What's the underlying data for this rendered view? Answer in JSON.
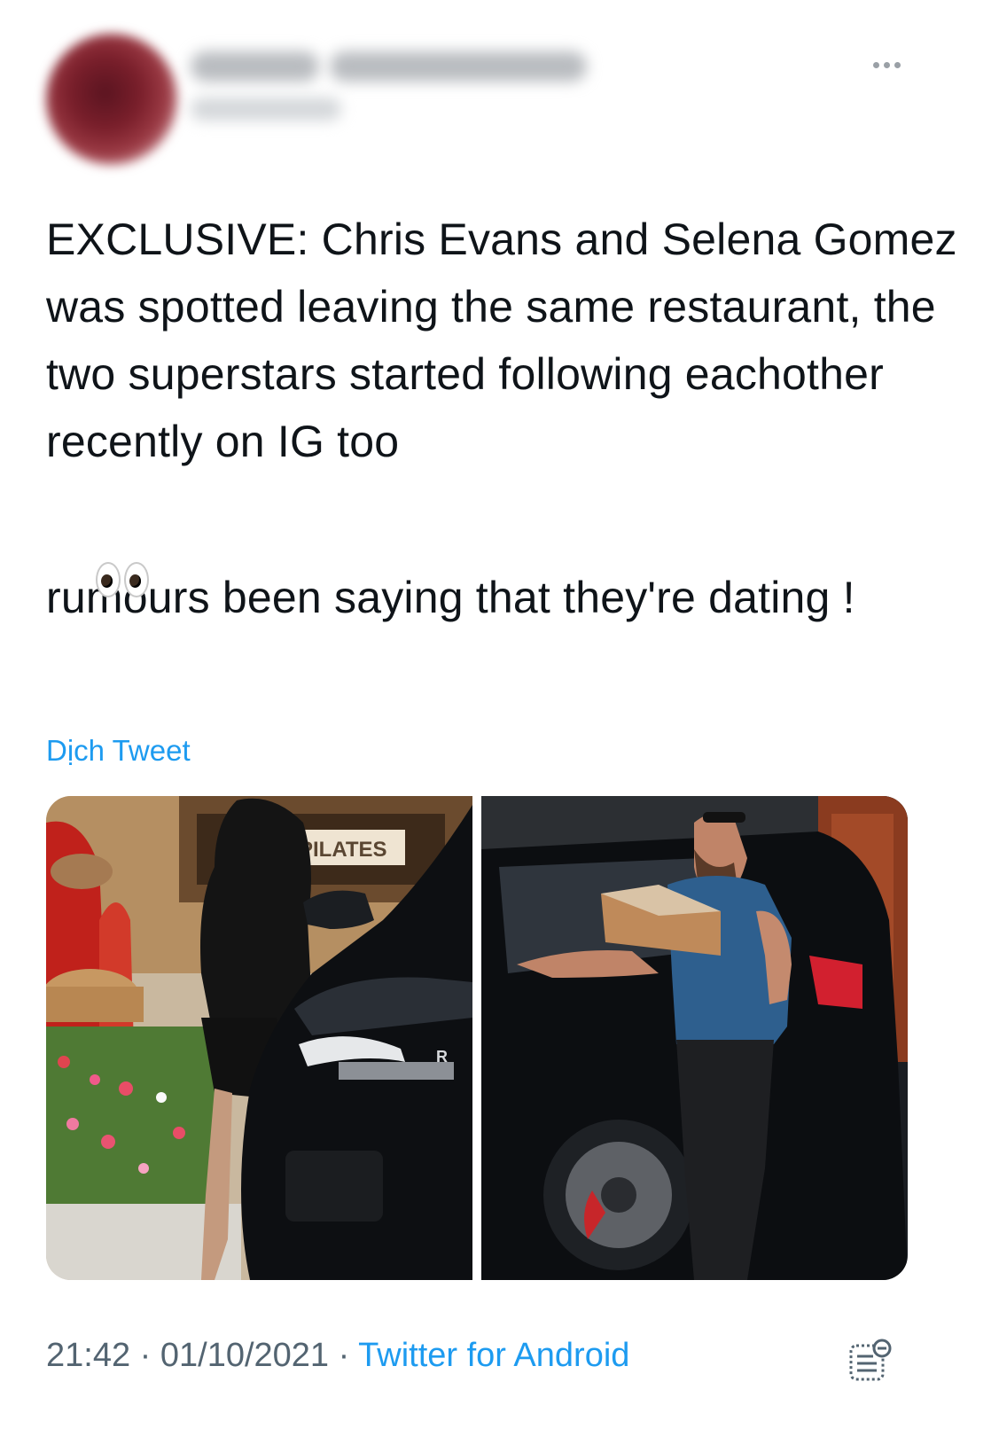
{
  "header": {
    "more_icon": "more-horizontal-icon"
  },
  "tweet": {
    "line1": "EXCLUSIVE: Chris Evans and Selena Gomez was spotted leaving the same restaurant, the two superstars started following eachother recently on IG too",
    "emoji": "eyes-emoji",
    "line2": "rumours been saying that they're dating !"
  },
  "translate_label": "Dịch Tweet",
  "media": {
    "left_photo_sign": "PILATES",
    "left_photo_grille": "R",
    "photo_count": 2
  },
  "meta": {
    "time": "21:42",
    "separator": " · ",
    "date": "01/10/2021",
    "source": "Twitter for Android",
    "analytics_icon": "analytics-icon"
  },
  "colors": {
    "link": "#1d9bf0",
    "text": "#0f1419",
    "secondary": "#536471"
  }
}
